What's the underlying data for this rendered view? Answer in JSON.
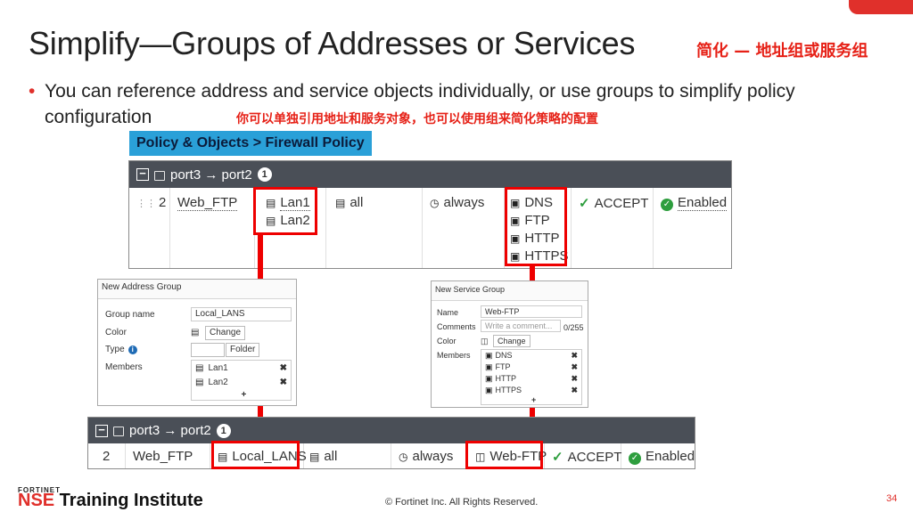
{
  "slide": {
    "title": "Simplify—Groups of Addresses or Services",
    "title_zh": "简化 — 地址组或服务组",
    "bullet": "You can reference address and service objects individually, or use groups to simplify policy configuration",
    "bullet_zh": "你可以单独引用地址和服务对象，也可以使用组来简化策略的配置",
    "nav_label": "Policy & Objects > Firewall Policy",
    "accent_color": "#e0302b"
  },
  "policy_before": {
    "interface_pair": "port3 → port2",
    "count": "1",
    "id": "2",
    "name": "Web_FTP",
    "sources": [
      "Lan1",
      "Lan2"
    ],
    "destination": "all",
    "schedule": "always",
    "services": [
      "DNS",
      "FTP",
      "HTTP",
      "HTTPS"
    ],
    "action": "ACCEPT",
    "status": "Enabled"
  },
  "address_group": {
    "title": "New Address Group",
    "group_name_label": "Group name",
    "group_name_value": "Local_LANS",
    "color_label": "Color",
    "change_label": "Change",
    "type_label": "Type",
    "type_options": [
      "Group",
      "Folder"
    ],
    "members_label": "Members",
    "members": [
      "Lan1",
      "Lan2"
    ]
  },
  "service_group": {
    "title": "New Service Group",
    "name_label": "Name",
    "name_value": "Web-FTP",
    "comments_label": "Comments",
    "comments_placeholder": "Write a comment...",
    "comments_counter": "0/255",
    "color_label": "Color",
    "change_label": "Change",
    "members_label": "Members",
    "members": [
      "DNS",
      "FTP",
      "HTTP",
      "HTTPS"
    ]
  },
  "policy_after": {
    "interface_pair": "port3 → port2",
    "count": "1",
    "id": "2",
    "name": "Web_FTP",
    "source": "Local_LANS",
    "destination": "all",
    "schedule": "always",
    "service": "Web-FTP",
    "action": "ACCEPT",
    "status": "Enabled"
  },
  "footer": {
    "brand_top": "FORTINET",
    "brand_nse": "NSE",
    "brand_rest": " Training Institute",
    "copyright": "© Fortinet Inc. All Rights Reserved.",
    "page": "34"
  }
}
